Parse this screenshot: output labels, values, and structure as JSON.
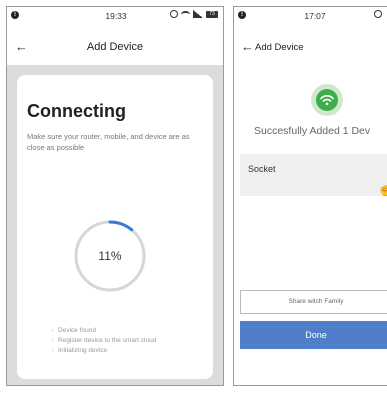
{
  "left_screen": {
    "status_bar": {
      "indicator": "!",
      "time": "19:33",
      "battery": "73"
    },
    "header": {
      "back": "←",
      "title": "Add Device"
    },
    "card": {
      "title": "Connecting",
      "instruction": "Make sure your router, mobile, and device are as close as possible",
      "progress_percent": 11,
      "progress_label": "11%",
      "steps": [
        "Device found",
        "Register device to the smart cloud",
        "Initializing device"
      ]
    }
  },
  "right_screen": {
    "status_bar": {
      "indicator": "!",
      "time": "17:07"
    },
    "header": {
      "back": "←",
      "title": "Add Device"
    },
    "success_icon": "wifi-icon",
    "success_message": "Succesfully Added 1 Dev",
    "device_name": "Socket",
    "share_button": "Share witch Family",
    "done_button": "Done"
  },
  "colors": {
    "accent_blue": "#4f7fc8",
    "success_green": "#3fae49",
    "progress_blue": "#3a7bd5",
    "background_gray": "#dcdcdc"
  }
}
